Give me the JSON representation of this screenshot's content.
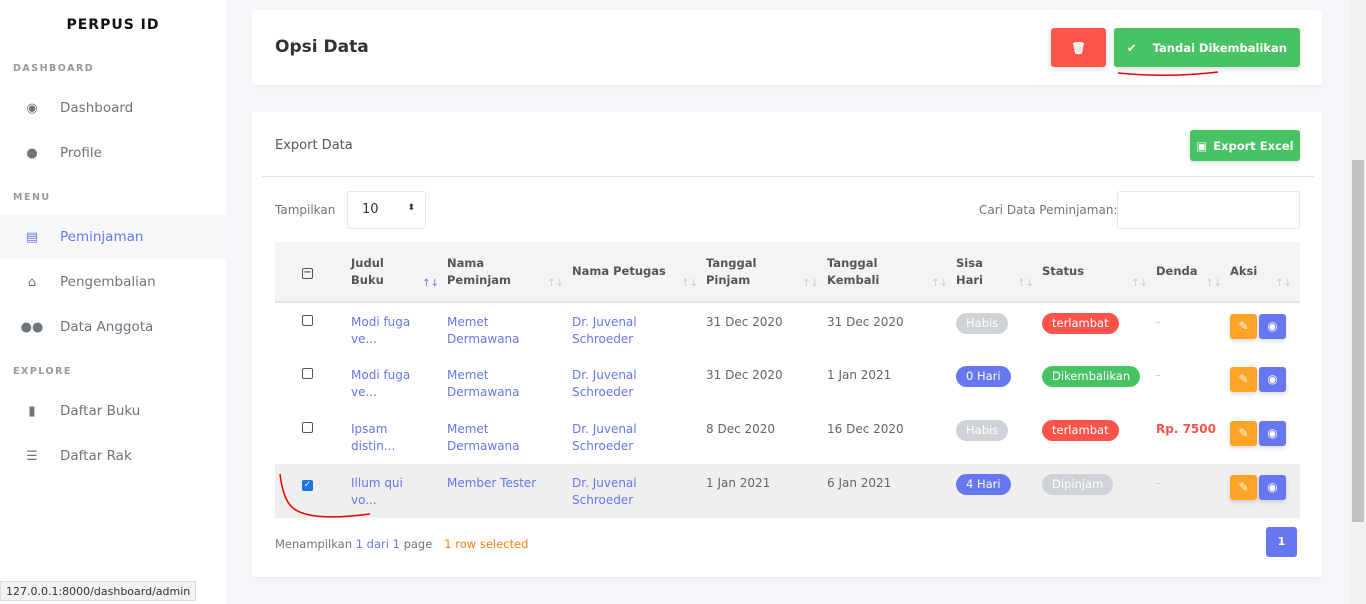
{
  "sidebar": {
    "brand": "PERPUS ID",
    "sections": [
      {
        "label": "DASHBOARD"
      },
      {
        "label": "MENU"
      },
      {
        "label": "EXPLORE"
      }
    ],
    "items": [
      {
        "label": "Dashboard",
        "icon": "compass-icon"
      },
      {
        "label": "Profile",
        "icon": "user-icon"
      },
      {
        "label": "Peminjaman",
        "icon": "card-icon",
        "active": true
      },
      {
        "label": "Pengembalian",
        "icon": "basket-icon"
      },
      {
        "label": "Data Anggota",
        "icon": "users-icon"
      },
      {
        "label": "Daftar Buku",
        "icon": "book-icon"
      },
      {
        "label": "Daftar Rak",
        "icon": "list-icon"
      }
    ]
  },
  "options": {
    "title": "Opsi Data",
    "delete_icon": "trash-icon",
    "mark_returned_label": "Tandai Dikembalikan"
  },
  "export": {
    "title": "Export Data",
    "excel_label": "Export Excel"
  },
  "controls": {
    "show_label": "Tampilkan",
    "show_value": "10",
    "search_label": "Cari Data Peminjaman:",
    "search_value": ""
  },
  "table": {
    "headers": [
      "Judul Buku",
      "Nama Peminjam",
      "Nama Petugas",
      "Tanggal Pinjam",
      "Tanggal Kembali",
      "Sisa Hari",
      "Status",
      "Denda",
      "Aksi"
    ],
    "rows": [
      {
        "checked": false,
        "judul": "Modi fuga ve...",
        "peminjam": "Memet Dermawana",
        "petugas": "Dr. Juvenal Schroeder",
        "pinjam": "31 Dec 2020",
        "kembali": "31 Dec 2020",
        "sisa": "Habis",
        "status": "terlambat",
        "denda": "-"
      },
      {
        "checked": false,
        "judul": "Modi fuga ve...",
        "peminjam": "Memet Dermawana",
        "petugas": "Dr. Juvenal Schroeder",
        "pinjam": "31 Dec 2020",
        "kembali": "1 Jan 2021",
        "sisa": "0 Hari",
        "status": "Dikembalikan",
        "denda": "-"
      },
      {
        "checked": false,
        "judul": "Ipsam distin...",
        "peminjam": "Memet Dermawana",
        "petugas": "Dr. Juvenal Schroeder",
        "pinjam": "8 Dec 2020",
        "kembali": "16 Dec 2020",
        "sisa": "Habis",
        "status": "terlambat",
        "denda": "Rp. 7500"
      },
      {
        "checked": true,
        "judul": "Illum qui vo...",
        "peminjam": "Member Tester",
        "petugas": "Dr. Juvenal Schroeder",
        "pinjam": "1 Jan 2021",
        "kembali": "6 Jan 2021",
        "sisa": "4 Hari",
        "status": "Dipinjam",
        "denda": "-"
      }
    ]
  },
  "footer": {
    "info_prefix": "Menampilkan",
    "info_page": "1 dari 1",
    "info_suffix": "page",
    "selected": "1 row selected",
    "page": "1"
  },
  "status_bar": "127.0.0.1:8000/dashboard/admin",
  "colors": {
    "primary": "#6777ef",
    "danger": "#fc544b",
    "success": "#47c363",
    "warning": "#ffa426",
    "secondary": "#cdd3d8"
  }
}
